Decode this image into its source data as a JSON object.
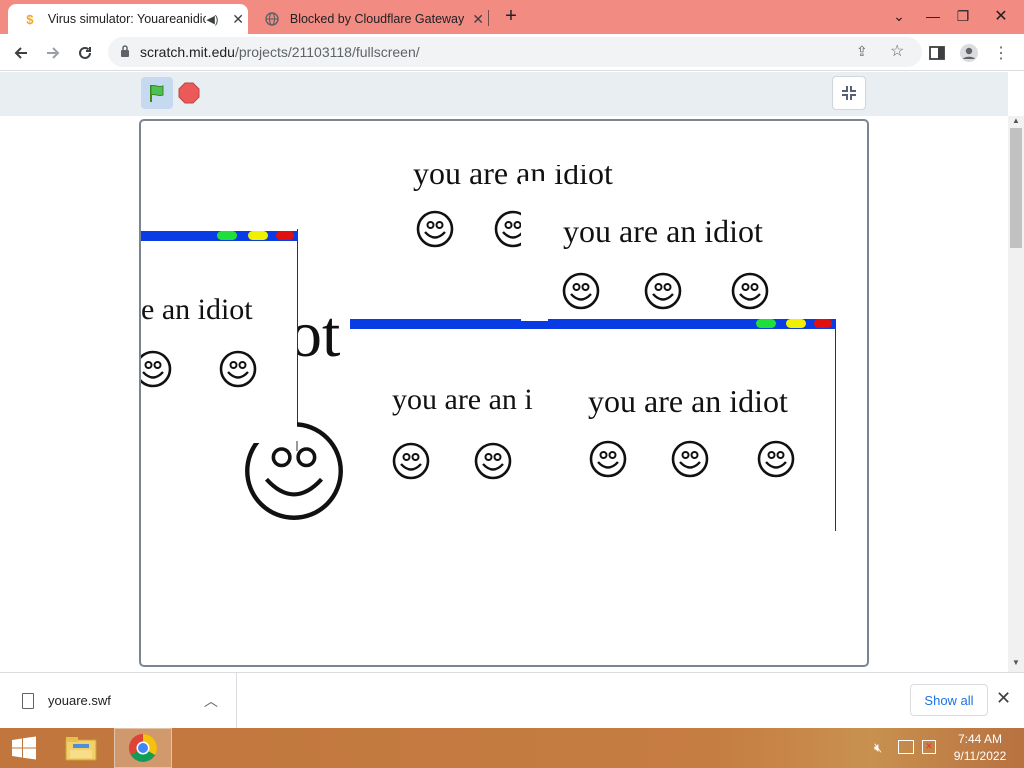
{
  "browser": {
    "tabs": [
      {
        "title": "Virus simulator: Youareanidiot",
        "active": true,
        "audio": true
      },
      {
        "title": "Blocked by Cloudflare Gateway",
        "active": false
      }
    ],
    "address": {
      "host": "scratch.mit.edu",
      "path": "/projects/21103118/fullscreen/"
    }
  },
  "stage": {
    "popup_text": "you are an idiot",
    "texts": [
      "you are an idiot",
      "e an idiot",
      "ot",
      "you are an i",
      "you are an idiot",
      "you are an idiot"
    ],
    "dot_colors": [
      "#1fe03a",
      "#f0f000",
      "#e01010"
    ],
    "bar_color": "#0a3ce6"
  },
  "downloads": {
    "filename": "youare.swf",
    "show_all": "Show all"
  },
  "taskbar": {
    "time": "7:44 AM",
    "date": "9/11/2022"
  }
}
